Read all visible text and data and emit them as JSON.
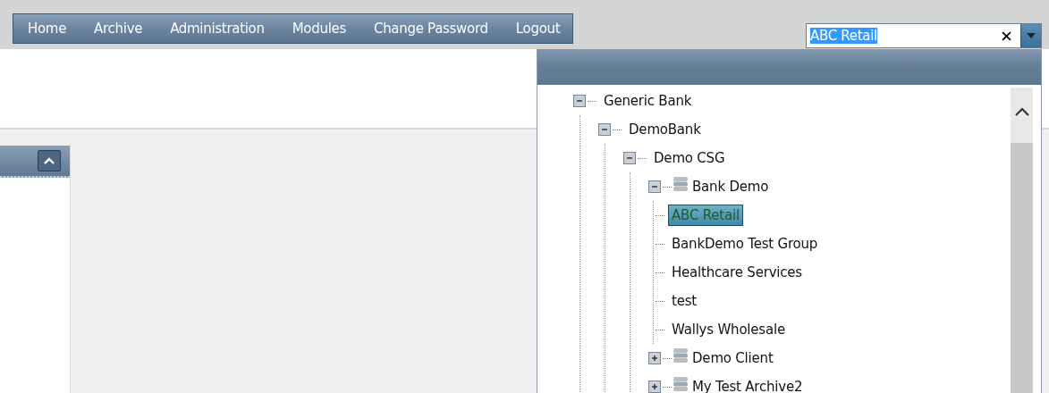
{
  "menu": [
    {
      "label": "Home"
    },
    {
      "label": "Archive"
    },
    {
      "label": "Administration"
    },
    {
      "label": "Modules"
    },
    {
      "label": "Change Password"
    },
    {
      "label": "Logout"
    }
  ],
  "selector": {
    "value": "ABC Retail",
    "value_highlighted": true
  },
  "tree": [
    {
      "label": "Generic Bank",
      "kind": "group",
      "expanded": true,
      "selected": false,
      "children": [
        {
          "label": "DemoBank",
          "kind": "group",
          "expanded": true,
          "selected": false,
          "children": [
            {
              "label": "Demo CSG",
              "kind": "group",
              "expanded": true,
              "selected": false,
              "children": [
                {
                  "label": "Bank Demo",
                  "kind": "archive",
                  "expanded": true,
                  "selected": false,
                  "children": [
                    {
                      "label": "ABC Retail",
                      "kind": "leaf",
                      "selected": true
                    },
                    {
                      "label": "BankDemo Test Group",
                      "kind": "leaf",
                      "selected": false
                    },
                    {
                      "label": "Healthcare Services",
                      "kind": "leaf",
                      "selected": false
                    },
                    {
                      "label": "test",
                      "kind": "leaf",
                      "selected": false
                    },
                    {
                      "label": "Wallys Wholesale",
                      "kind": "leaf",
                      "selected": false
                    }
                  ]
                },
                {
                  "label": "Demo Client",
                  "kind": "archive",
                  "expanded": false,
                  "selected": false
                },
                {
                  "label": "My Test Archive2",
                  "kind": "archive",
                  "expanded": false,
                  "selected": false
                }
              ]
            }
          ]
        }
      ]
    }
  ]
}
